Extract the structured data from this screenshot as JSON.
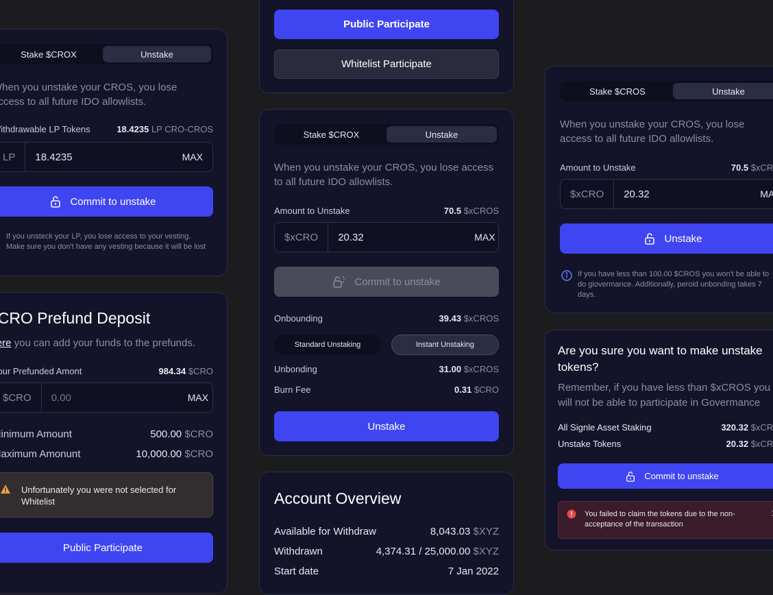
{
  "c1": {
    "tab_stake": "Stake $CROX",
    "tab_unstake": "Unstake",
    "desc": "When you unstake your CROS, you lose access to all future IDO allowlists.",
    "lp_label": "Withdrawable LP Tokens",
    "lp_value": "18.4235",
    "lp_unit": "LP CRO-CROS",
    "input_prefix": "LP",
    "input_value": "18.4235",
    "max": "MAX",
    "commit": "Commit to unstake",
    "note": "If you unsteck your LP, you lose access to your vesting. Make sure you don't have any vesting because it will be lost"
  },
  "c2": {
    "title": "$CRO Prefund Deposit",
    "here": "Here",
    "desc": " you can add your funds to the prefunds.",
    "prefund_label": "Your Prefunded Amont",
    "prefund_value": "984.34",
    "prefund_unit": "$CRO",
    "input_prefix": "$CRO",
    "input_placeholder": "0.00",
    "max": "MAX",
    "min_label": "Minimum Amount",
    "min_value": "500.00",
    "max_label": "Maximum Amonunt",
    "max_value": "10,000.00",
    "unit": "$CRO",
    "warning": "Unfortunately you were not selected for Whitelist",
    "public": "Public Participate"
  },
  "c3": {
    "public": "Public Participate",
    "whitelist": "Whitelist Participate"
  },
  "c4": {
    "tab_stake": "Stake $CROX",
    "tab_unstake": "Unstake",
    "desc": "When you unstake your CROS, you lose access to all future IDO allowlists.",
    "amount_label": "Amount to Unstake",
    "amount_value": "70.5",
    "amount_unit": "$xCROS",
    "input_prefix": "$xCRO",
    "input_value": "20.32",
    "max": "MAX",
    "commit": "Commit to unstake",
    "onbounding_label": "Onbounding",
    "onbounding_value": "39.43",
    "onbounding_unit": "$xCROS",
    "standard": "Standard Unstaking",
    "instant": "Instant Unstaking",
    "unbonding_label": "Unbonding",
    "unbonding_value": "31.00",
    "unbonding_unit": "$xCROS",
    "burn_label": "Burn Fee",
    "burn_value": "0.31",
    "burn_unit": "$CRO",
    "unstake": "Unstake"
  },
  "c5": {
    "title": "Account Overview",
    "avail_label": "Available for Withdraw",
    "avail_value": "8,043.03",
    "withdrawn_label": "Withdrawn",
    "withdrawn_value": "4,374.31 / 25,000.00",
    "start_label": "Start date",
    "start_value": "7 Jan 2022",
    "unit": "$XYZ"
  },
  "c6": {
    "tab_stake": "Stake $CROS",
    "tab_unstake": "Unstake",
    "desc": "When you unstake your CROS, you lose access to all future IDO allowlists.",
    "amount_label": "Amount to Unstake",
    "amount_value": "70.5",
    "amount_unit": "$xCROS",
    "input_prefix": "$xCRO",
    "input_value": "20.32",
    "max": "MAX",
    "unstake": "Unstake",
    "info": "If you have less than 100.00 $CROS you won't be able to do giovermance. Additionally, peroid unbonding takes 7 days."
  },
  "c7": {
    "title": "Are you sure you want to make unstake tokens?",
    "desc": "Remember, if you have less than $xCROS you will not be able to participate in Govermance",
    "all_label": "All Signle Asset Staking",
    "all_value": "320.32",
    "unstake_label": "Unstake Tokens",
    "unstake_value": "20.32",
    "unit": "$xCROS",
    "commit": "Commit to unstake",
    "error": "You failed to claim the tokens due to the non-acceptance of the transaction"
  },
  "colors": {
    "accent": "#4045f2",
    "warning": "#f0a43a",
    "error": "#e5484d",
    "info": "#5b7cf7"
  },
  "icons": [
    "unlock-icon",
    "loading-unlock-icon",
    "warning-icon",
    "info-icon",
    "error-icon",
    "close-icon"
  ]
}
